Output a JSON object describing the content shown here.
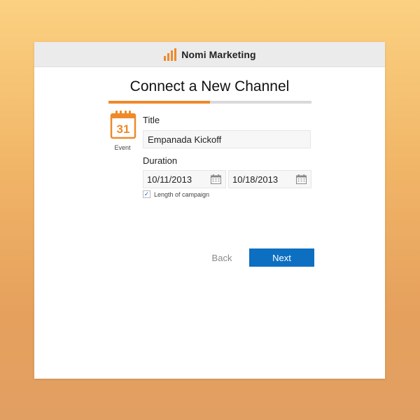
{
  "app": {
    "name": "Nomi Marketing",
    "logo_icon": "bar-chart-logo-icon",
    "brand_color": "#ee8a2a"
  },
  "wizard": {
    "heading": "Connect a New Channel",
    "progress_fraction": 0.5
  },
  "channel": {
    "type_label": "Event",
    "icon": "calendar-icon",
    "icon_day": "31"
  },
  "form": {
    "title_label": "Title",
    "title_value": "Empanada Kickoff",
    "duration_label": "Duration",
    "start_date": "10/11/2013",
    "end_date": "10/18/2013",
    "length_checkbox_label": "Length of campaign",
    "length_checkbox_checked": true
  },
  "actions": {
    "back_label": "Back",
    "next_label": "Next",
    "primary_color": "#0d6fc1"
  }
}
